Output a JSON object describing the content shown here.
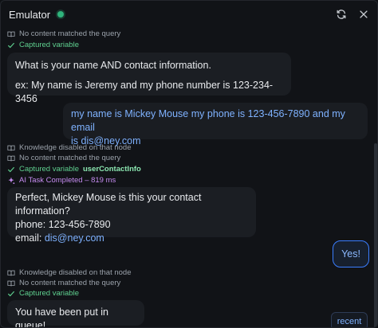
{
  "header": {
    "title": "Emulator",
    "status_color": "#2fb47c",
    "actions": [
      "refresh-icon",
      "close-icon"
    ]
  },
  "messages": [
    {
      "meta": [
        {
          "type": "kb",
          "text": "No content matched the query"
        },
        {
          "type": "captured",
          "text": "Captured variable",
          "var": ""
        }
      ],
      "bot": {
        "line1": "What is your name AND contact information.",
        "line2": "ex: My name is Jeremy and my phone number is 123-234-3456"
      }
    },
    {
      "user": {
        "line1": "my name is Mickey Mouse my phone is 123-456-7890 and my email",
        "line2": "is dis@ney.com"
      }
    },
    {
      "meta": [
        {
          "type": "kb",
          "text": "Knowledge disabled on that node"
        },
        {
          "type": "kb",
          "text": "No content matched the query"
        },
        {
          "type": "captured",
          "text": "Captured variable",
          "var": "userContactInfo"
        },
        {
          "type": "ai",
          "text": "AI Task Completed – 819 ms"
        }
      ],
      "bot": {
        "line1": "Perfect, Mickey Mouse is this your contact information?",
        "line2": "phone: 123-456-7890",
        "line3_label": "email: ",
        "line3_link": "dis@ney.com"
      }
    },
    {
      "user": {
        "text": "Yes!"
      }
    },
    {
      "meta": [
        {
          "type": "kb",
          "text": "Knowledge disabled on that node"
        },
        {
          "type": "kb",
          "text": "No content matched the query"
        },
        {
          "type": "captured",
          "text": "Captured variable",
          "var": ""
        }
      ],
      "bot": {
        "line1": "You have been put in queue!"
      }
    }
  ],
  "recent_button": "recent"
}
